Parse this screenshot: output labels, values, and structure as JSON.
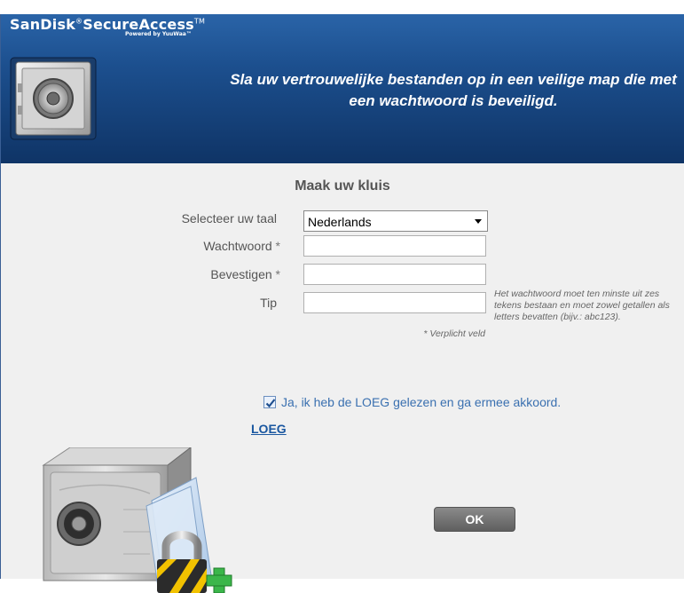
{
  "header": {
    "brand": "SanDisk",
    "brand_mark": "®",
    "product": "SecureAccess",
    "product_mark": "TM",
    "powered_by": "Powered by YuuWaa™",
    "tagline": "Sla uw vertrouwelijke bestanden op in een veilige map die met een wachtwoord is beveiligd.",
    "logo_icon": "safe-icon"
  },
  "form": {
    "title": "Maak uw kluis",
    "language_label": "Selecteer uw taal",
    "language_value": "Nederlands",
    "password_label": "Wachtwoord",
    "password_value": "",
    "confirm_label": "Bevestigen",
    "confirm_value": "",
    "tip_label": "Tip",
    "tip_value": "",
    "required_marker": "*",
    "required_note": "* Verplicht veld",
    "password_hint": "Het wachtwoord moet ten minste uit zes tekens bestaan en moet zowel getallen als letters bevatten (bijv.: abc123).",
    "agree_checked": true,
    "agree_text": "Ja, ik heb de LOEG gelezen en ga ermee akkoord.",
    "eula_link": "LOEG",
    "ok_label": "OK"
  },
  "colors": {
    "header_top": "#2a64a8",
    "header_bottom": "#0f3466",
    "body_bg": "#f0f0f0",
    "link": "#1a57a0",
    "agree_text": "#3a70b0",
    "button": "#6e6e6e"
  }
}
